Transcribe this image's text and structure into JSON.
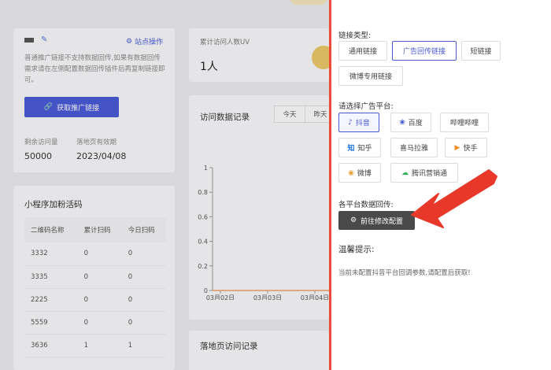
{
  "left": {
    "promo_card": {
      "site_ops_label": "站点操作",
      "note": "普通推广链接不支持数据回传,如果有数据回传需求请在左侧配置数据回传插件后再复制链接即可。",
      "get_link_button": "获取推广链接",
      "remaining_label": "剩余访问量",
      "remaining_value": "50000",
      "expiry_label": "落地页有效期",
      "expiry_value": "2023/04/08"
    },
    "uv_card": {
      "label": "累计访问人数UV",
      "value": "1人"
    },
    "visits_card": {
      "title": "访问数据记录",
      "tabs": [
        "今天",
        "昨天"
      ]
    },
    "qr_card": {
      "title": "小程序加粉活码",
      "columns": [
        "二维码名称",
        "累计扫码",
        "今日扫码"
      ],
      "rows": [
        [
          "3332",
          "0",
          "0"
        ],
        [
          "3335",
          "0",
          "0"
        ],
        [
          "2225",
          "0",
          "0"
        ],
        [
          "5559",
          "0",
          "0"
        ],
        [
          "3636",
          "1",
          "1"
        ]
      ]
    },
    "landing_card": {
      "title": "落地页访问记录"
    }
  },
  "chart_data": {
    "type": "line",
    "x": [
      "03月02日",
      "03月03日",
      "03月04日"
    ],
    "y_ticks": [
      "1",
      "0.8",
      "0.6",
      "0.4",
      "0.2",
      "0"
    ],
    "series": [
      {
        "values": [
          0,
          0,
          0
        ]
      }
    ],
    "ylim": [
      0,
      1
    ],
    "line_color": "#f0a060"
  },
  "panel": {
    "link_type_label": "链接类型:",
    "link_types": [
      "通用链接",
      "广告回传链接",
      "短链接",
      "微博专用链接"
    ],
    "platform_label": "请选择广告平台:",
    "platforms": [
      "抖音",
      "百度",
      "哔哩哔哩",
      "知乎",
      "喜马拉雅",
      "快手",
      "微博",
      "腾讯营销通"
    ],
    "callback_label": "各平台数据回传:",
    "config_button": "前往修改配置",
    "tip_title": "温馨提示:",
    "tip_text": "当前未配置抖音平台回调参数,请配置后获取!"
  },
  "colors": {
    "accent": "#4a5ad6",
    "highlight_border": "#ee4a3a",
    "arrow": "#e8382a",
    "config_button_bg": "#4a4a4a"
  },
  "icons": {
    "link": "link-icon",
    "settings": "gear-icon",
    "douyin": "douyin-icon",
    "baidu": "baidu-paw-icon",
    "zhihu": "zhihu-icon",
    "kuaishou": "kuaishou-icon",
    "weibo": "weibo-icon",
    "tencent": "tencent-cloud-icon"
  }
}
